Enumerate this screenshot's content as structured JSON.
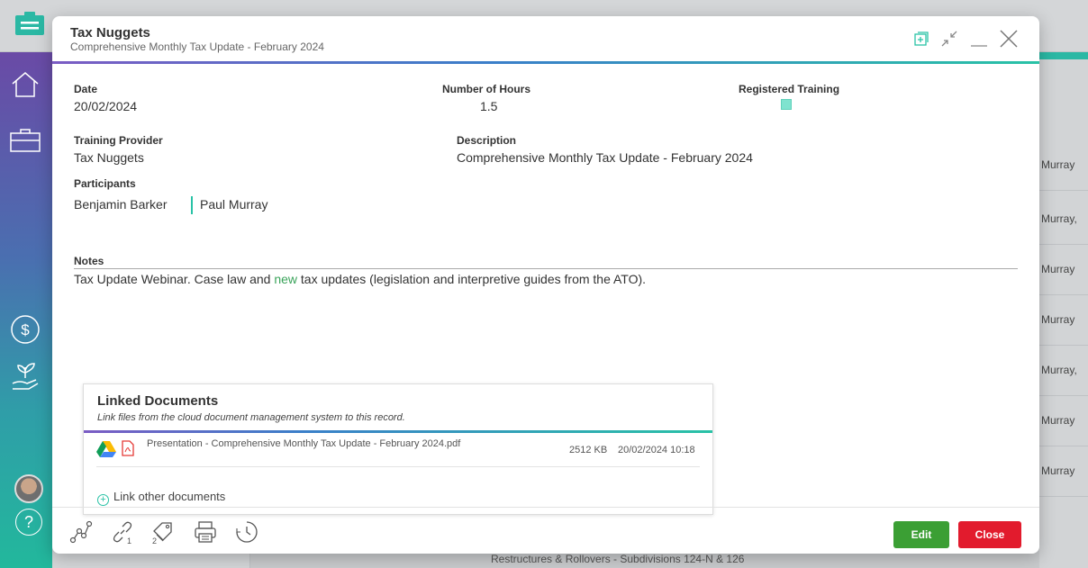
{
  "modal": {
    "title": "Tax Nuggets",
    "subtitle": "Comprehensive Monthly Tax Update - February 2024"
  },
  "fields": {
    "date_label": "Date",
    "date_value": "20/02/2024",
    "hours_label": "Number of Hours",
    "hours_value": "1.5",
    "registered_label": "Registered Training",
    "registered_checked": true,
    "provider_label": "Training Provider",
    "provider_value": "Tax Nuggets",
    "description_label": "Description",
    "description_value": "Comprehensive Monthly Tax Update - February 2024",
    "participants_label": "Participants",
    "participants": [
      "Benjamin Barker",
      "Paul Murray"
    ],
    "notes_label": "Notes",
    "notes_before": "Tax Update Webinar. Case law and ",
    "notes_highlight": "new",
    "notes_after": " tax updates (legislation and interpretive guides from the ATO)."
  },
  "documents": {
    "title": "Linked Documents",
    "subtitle": "Link files from the cloud document management system to this record.",
    "items": [
      {
        "name": "Presentation - Comprehensive Monthly Tax Update - February 2024.pdf",
        "size": "2512 KB",
        "date": "20/02/2024 10:18",
        "source_icon": "google-drive-icon",
        "type_icon": "pdf-icon"
      }
    ],
    "link_other": "Link other documents"
  },
  "footer": {
    "link_count": "1",
    "tag_count": "2",
    "edit_label": "Edit",
    "close_label": "Close"
  },
  "background": {
    "right_rows": [
      "l Murray",
      "l Murray,",
      "l Murray",
      "l Murray",
      "l Murray,",
      "l Murray",
      "l Murray"
    ],
    "bottom_text": "Restructures & Rollovers - Subdivisions 124-N & 126"
  },
  "colors": {
    "accent_teal": "#29c2a6",
    "accent_purple": "#7b5cc4",
    "edit_green": "#3b9f34",
    "close_red": "#e21b2d"
  }
}
